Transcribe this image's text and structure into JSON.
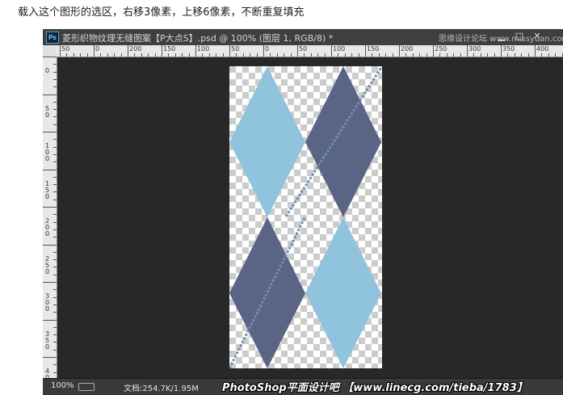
{
  "caption": "载入这个图形的选区，右移3像素，上移6像素，不断重复填充",
  "window": {
    "app_icon": "Ps",
    "title": "菱形织物纹理无缝图案【P大点S】.psd @ 100% (图层 1, RGB/8) *",
    "watermark_top": "思缘设计论坛 www.missyuan.com",
    "buttons": {
      "minimize": "▁",
      "maximize": "□",
      "close": "✕"
    }
  },
  "ruler": {
    "h_labels": [
      "0",
      "100",
      "50",
      "0",
      "50",
      "100",
      "150",
      "200",
      "250",
      "300",
      "350",
      "400",
      "150",
      "200",
      "250"
    ],
    "h_labels_ordered": [
      "50",
      "0",
      "200",
      "150",
      "100",
      "50",
      "0",
      "50",
      "100",
      "150",
      "200",
      "250",
      "300",
      "350",
      "400"
    ],
    "v_labels": [
      "0",
      "50",
      "100",
      "150",
      "200",
      "250",
      "300",
      "350",
      "400"
    ]
  },
  "status": {
    "zoom": "100%",
    "doc_info": "文档:254.7K/1.95M",
    "watermark_bottom": "PhotoShop平面设计吧 【www.linecg.com/tieba/1783】"
  },
  "colors": {
    "light_diamond": "#8fc4dc",
    "dark_diamond": "#5a6586",
    "stitch": "#6f8fb0"
  }
}
